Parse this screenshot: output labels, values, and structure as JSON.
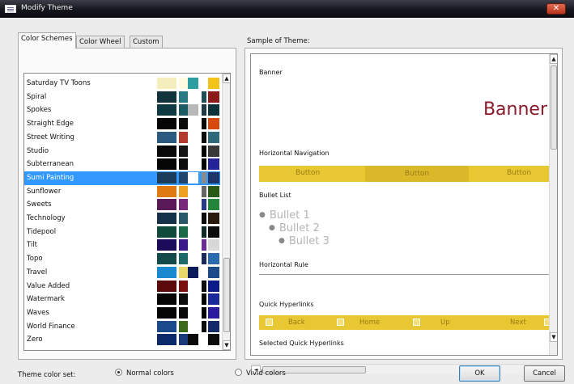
{
  "window": {
    "title": "Modify Theme",
    "close_glyph": "✕"
  },
  "tabs": [
    {
      "label": "Color Schemes",
      "active": true
    },
    {
      "label": "Color Wheel",
      "active": false
    },
    {
      "label": "Custom",
      "active": false
    }
  ],
  "schemes": [
    {
      "name": "Saturday TV Toons",
      "colors": [
        "#f4eebc",
        "#fffbe0",
        "#2a9ea0",
        "#ffffff",
        "#f2c419",
        "#c23a2a"
      ]
    },
    {
      "name": "Spiral",
      "colors": [
        "#12343c",
        "#2a7a86",
        "#ffffff",
        "#1f4f58",
        "#8b1a1a",
        "#0f2a30"
      ]
    },
    {
      "name": "Spokes",
      "colors": [
        "#0e3a44",
        "#1c5a64",
        "#b8b8b8",
        "#1e3c44",
        "#0b3338",
        "#d6d6d6"
      ]
    },
    {
      "name": "Straight Edge",
      "colors": [
        "#050505",
        "#0a0a0a",
        "#ffffff",
        "#070707",
        "#d64a0e",
        "#141414"
      ]
    },
    {
      "name": "Street Writing",
      "colors": [
        "#2b5a80",
        "#b33b2d",
        "#ffffff",
        "#0a0a0a",
        "#2f6a7a",
        "#0b0b0b"
      ]
    },
    {
      "name": "Studio",
      "colors": [
        "#090909",
        "#141414",
        "#ffffff",
        "#050505",
        "#383838",
        "#1e1e1e"
      ]
    },
    {
      "name": "Subterranean",
      "colors": [
        "#050505",
        "#0c0c0c",
        "#ffffff",
        "#050505",
        "#242498",
        "#111111"
      ]
    },
    {
      "name": "Sumi Painting",
      "colors": [
        "#1c3c5c",
        "#21446a",
        "#ffffff",
        "#8a8a8a",
        "#1c3468",
        "#3366bb"
      ]
    },
    {
      "name": "Sunflower",
      "colors": [
        "#e07a12",
        "#f0a020",
        "#ffffff",
        "#666666",
        "#2a5a18",
        "#c8a010"
      ]
    },
    {
      "name": "Sweets",
      "colors": [
        "#5a1a5a",
        "#7a2a7a",
        "#ffffff",
        "#2a3a8a",
        "#24863a",
        "#d06a90"
      ]
    },
    {
      "name": "Technology",
      "colors": [
        "#16324a",
        "#2a5a6a",
        "#ffffff",
        "#0a0a0a",
        "#2a1a0a",
        "#50300a"
      ]
    },
    {
      "name": "Tidepool",
      "colors": [
        "#0f4a3a",
        "#1a6a4a",
        "#ffffff",
        "#102a28",
        "#0c0c0c",
        "#4a8a5a"
      ]
    },
    {
      "name": "Tilt",
      "colors": [
        "#1c0a5a",
        "#3a1a8a",
        "#ffffff",
        "#6a2a9a",
        "#d8d8d8",
        "#8a5ad0"
      ]
    },
    {
      "name": "Topo",
      "colors": [
        "#144a4a",
        "#1e6a6a",
        "#ffffff",
        "#1a2a5a",
        "#2a6ab0",
        "#0c0c0c"
      ]
    },
    {
      "name": "Travel",
      "colors": [
        "#1a8ad0",
        "#e8d86a",
        "#0a1a5a",
        "#ffffff",
        "#1d4a8a",
        "#f2c419"
      ]
    },
    {
      "name": "Value Added",
      "colors": [
        "#5a0a0a",
        "#7a1010",
        "#ffffff",
        "#0a0a0a",
        "#0a1a8a",
        "#1a3ab0"
      ]
    },
    {
      "name": "Watermark",
      "colors": [
        "#050505",
        "#0c0c0c",
        "#ffffff",
        "#050505",
        "#1a2a9a",
        "#2a5ae0"
      ]
    },
    {
      "name": "Waves",
      "colors": [
        "#050505",
        "#0a0a0a",
        "#ffffff",
        "#050505",
        "#2a1aa0",
        "#3a2ad0"
      ]
    },
    {
      "name": "World Finance",
      "colors": [
        "#1a4a8a",
        "#3a6a1a",
        "#ffffff",
        "#0a0a0a",
        "#142a6a",
        "#c8a030"
      ]
    },
    {
      "name": "Zero",
      "colors": [
        "#0a2a6a",
        "#1a3a7a",
        "#0a0a0a",
        "#ffffff",
        "#0a0a0a",
        "#1a3ab0"
      ]
    }
  ],
  "selected_scheme": "Sumi Painting",
  "sample": {
    "label": "Sample of Theme:",
    "banner_heading": "Banner",
    "banner_text": "Banner",
    "nav_heading": "Horizontal Navigation",
    "nav_buttons": [
      "Button",
      "Button",
      "Button"
    ],
    "bullet_heading": "Bullet List",
    "bullets": [
      "Bullet 1",
      "Bullet 2",
      "Bullet 3"
    ],
    "rule_heading": "Horizontal Rule",
    "quick_heading": "Quick Hyperlinks",
    "quick_links": [
      "Back",
      "Home",
      "Up",
      "Next"
    ],
    "selected_quick_heading": "Selected Quick Hyperlinks",
    "accent": "#e7c832",
    "banner_color": "#8b1a2b"
  },
  "footer": {
    "label": "Theme color set:",
    "normal": "Normal colors",
    "vivid": "Vivid colors",
    "selected": "Normal colors"
  },
  "buttons": {
    "ok": "OK",
    "cancel": "Cancel"
  },
  "scroll_glyphs": {
    "up": "▲",
    "down": "▼",
    "left": "◄",
    "right": "►"
  }
}
